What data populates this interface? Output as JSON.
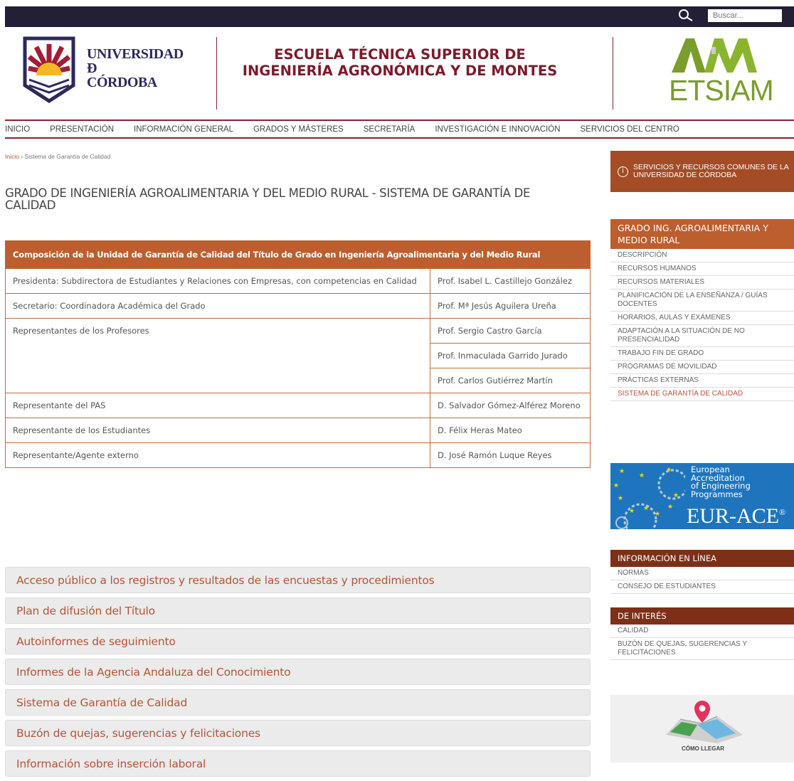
{
  "topbar": {
    "search_placeholder": "Buscar..."
  },
  "header": {
    "university_line1": "UNIVERSIDAD",
    "university_line2": "Ð",
    "university_line3": "CÓRDOBA",
    "school_title": "ESCUELA TÉCNICA SUPERIOR DE INGENIERÍA AGRONÓMICA Y DE MONTES",
    "etsiam_word": "ETSIAM"
  },
  "nav": [
    "INICIO",
    "PRESENTACIÓN",
    "INFORMACIÓN GENERAL",
    "GRADOS Y MÁSTERES",
    "SECRETARÍA",
    "INVESTIGACIÓN E INNOVACIÓN",
    "SERVICIOS DEL CENTRO"
  ],
  "breadcrumb": {
    "home": "Inicio",
    "separator": " › ",
    "current": "Sistema de Garantía de Calidad"
  },
  "page_title": "GRADO DE INGENIERÍA AGROALIMENTARIA Y DEL MEDIO RURAL - SISTEMA DE GARANTÍA DE CALIDAD",
  "table": {
    "header": "Composición de la Unidad de Garantía de Calidad del Título de Grado en Ingeniería Agroalimentaria y del Medio Rural",
    "rows": [
      {
        "role": "Presidenta: Subdirectora de Estudiantes y Relaciones con Empresas, con competencias en Calidad",
        "people": [
          "Prof. Isabel L. Castillejo González"
        ]
      },
      {
        "role": "Secretario: Coordinadora Académica del Grado",
        "people": [
          "Prof. Mª Jesús Aguilera Ureña"
        ]
      },
      {
        "role": "Representantes de los Profesores",
        "people": [
          "Prof. Sergio Castro García",
          "Prof. Inmaculada Garrido Jurado",
          "Prof. Carlos Gutiérrez Martín"
        ]
      },
      {
        "role": "Representante del PAS",
        "people": [
          "D. Salvador Gómez-Alférez Moreno"
        ]
      },
      {
        "role": "Representante de los Estudiantes",
        "people": [
          "D. Félix Heras Mateo"
        ]
      },
      {
        "role": "Representante/Agente externo",
        "people": [
          "D. José Ramón Luque Reyes"
        ]
      }
    ]
  },
  "accordion": [
    "Acceso público a los registros y resultados de las encuestas y procedimientos",
    "Plan de difusión del Título",
    "Autoinformes de seguimiento",
    "Informes de la Agencia Andaluza del Conocimiento",
    "Sistema de Garantía de Calidad",
    "Buzón de quejas, sugerencias y felicitaciones",
    "Información sobre inserción laboral"
  ],
  "sidebar": {
    "services_label": "SERVICIOS Y RECURSOS COMUNES DE LA UNIVERSIDAD DE CÓRDOBA",
    "grado_title": "GRADO ING. AGROALIMENTARIA Y MEDIO RURAL",
    "grado_links": [
      "DESCRIPCIÓN",
      "RECURSOS HUMANOS",
      "RECURSOS MATERIALES",
      "PLANIFICACIÓN DE LA ENSEÑANZA / GUÍAS DOCENTES",
      "HORARIOS, AULAS Y EXÁMENES",
      "ADAPTACIÓN A LA SITUACIÓN DE NO PRESENCIALIDAD",
      "TRABAJO FIN DE GRADO",
      "PROGRAMAS DE MOVILIDAD",
      "PRÁCTICAS EXTERNAS",
      "SISTEMA DE GARANTÍA DE CALIDAD"
    ],
    "grado_active_index": 9,
    "eurace_lines": [
      "European",
      "Accreditation",
      "of Engineering",
      "Programmes"
    ],
    "eurace_big": "EUR-ACE",
    "eurace_reg": "®",
    "info_title": "INFORMACIÓN EN LÍNEA",
    "info_links": [
      "NORMAS",
      "CONSEJO DE ESTUDIANTES"
    ],
    "interest_title": "DE INTERÉS",
    "interest_links": [
      "CALIDAD",
      "BUZÓN DE QUEJAS, SUGERENCIAS Y FELICITACIONES"
    ],
    "map_caption": "CÓMO LLEGAR"
  },
  "colors": {
    "brand_dark": "#231f36",
    "accent": "#bd5e2e",
    "maroon": "#8b2232",
    "link_active": "#c14f3a"
  }
}
